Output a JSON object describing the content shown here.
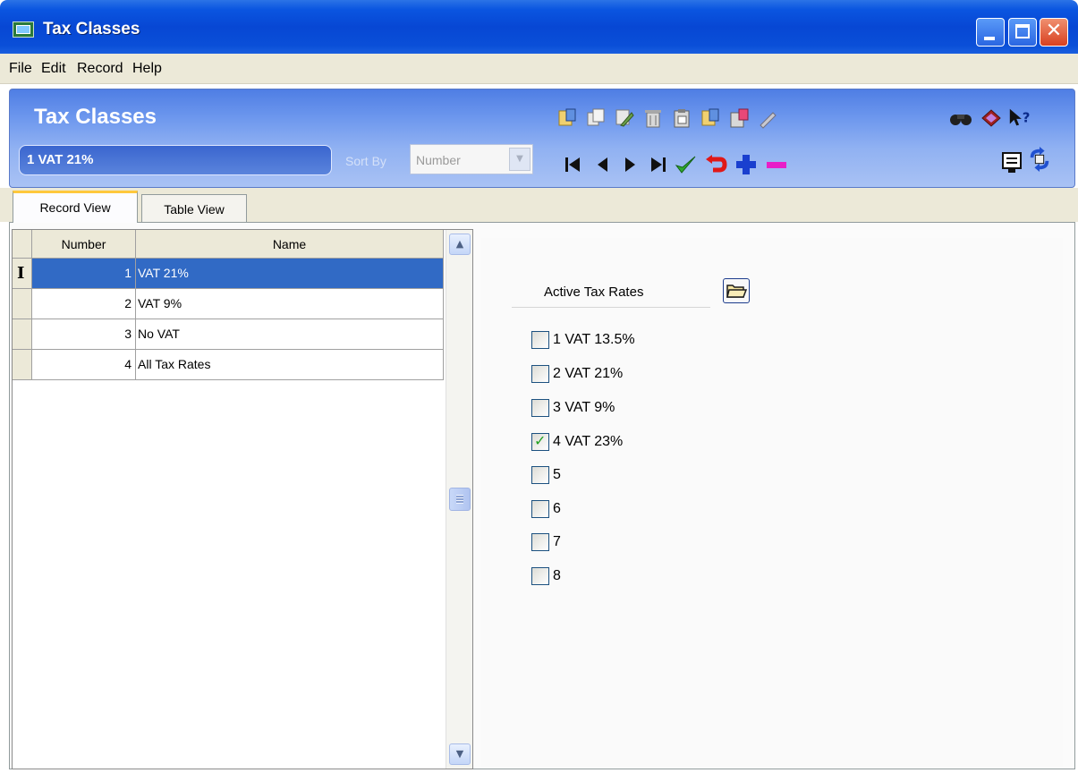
{
  "window": {
    "title": "Tax Classes",
    "buttons": {
      "minimize": "minimize",
      "maximize": "maximize",
      "close": "✕"
    }
  },
  "menu": [
    "File",
    "Edit",
    "Record",
    "Help"
  ],
  "header": {
    "title": "Tax Classes",
    "current_record": "1 VAT 21%",
    "sort_by_label": "Sort By",
    "sort_by_value": "Number"
  },
  "toolbar": {
    "edit_icons": [
      "new-record-icon",
      "copy-record-icon",
      "edit-record-icon",
      "delete-record-icon",
      "paste-icon",
      "save-icon",
      "import-icon",
      "pen-icon"
    ],
    "nav_icons": [
      "first-record-icon",
      "previous-record-icon",
      "next-record-icon",
      "last-record-icon",
      "confirm-icon",
      "undo-icon",
      "add-icon",
      "remove-icon"
    ],
    "help_icons": [
      "find-icon",
      "book-icon",
      "help-pointer-icon"
    ],
    "view_icons": [
      "screen-icon",
      "refresh-icon"
    ]
  },
  "tabs": [
    {
      "label": "Record View",
      "active": true
    },
    {
      "label": "Table View",
      "active": false
    }
  ],
  "grid": {
    "columns": [
      "Number",
      "Name"
    ],
    "rows": [
      {
        "number": "1",
        "name": "VAT 21%",
        "selected": true
      },
      {
        "number": "2",
        "name": "VAT 9%",
        "selected": false
      },
      {
        "number": "3",
        "name": "No VAT",
        "selected": false
      },
      {
        "number": "4",
        "name": "All Tax Rates",
        "selected": false
      }
    ]
  },
  "rates": {
    "title": "Active Tax Rates",
    "items": [
      {
        "label": "1  VAT 13.5%",
        "checked": false
      },
      {
        "label": "2  VAT 21%",
        "checked": false
      },
      {
        "label": "3  VAT 9%",
        "checked": false
      },
      {
        "label": "4  VAT 23%",
        "checked": true
      },
      {
        "label": "5",
        "checked": false
      },
      {
        "label": "6",
        "checked": false
      },
      {
        "label": "7",
        "checked": false
      },
      {
        "label": "8",
        "checked": false
      }
    ]
  },
  "colors": {
    "titlebar": "#0747d4",
    "selection": "#316ac5",
    "check": "#21a121",
    "header_panel": "#6e98ee"
  }
}
